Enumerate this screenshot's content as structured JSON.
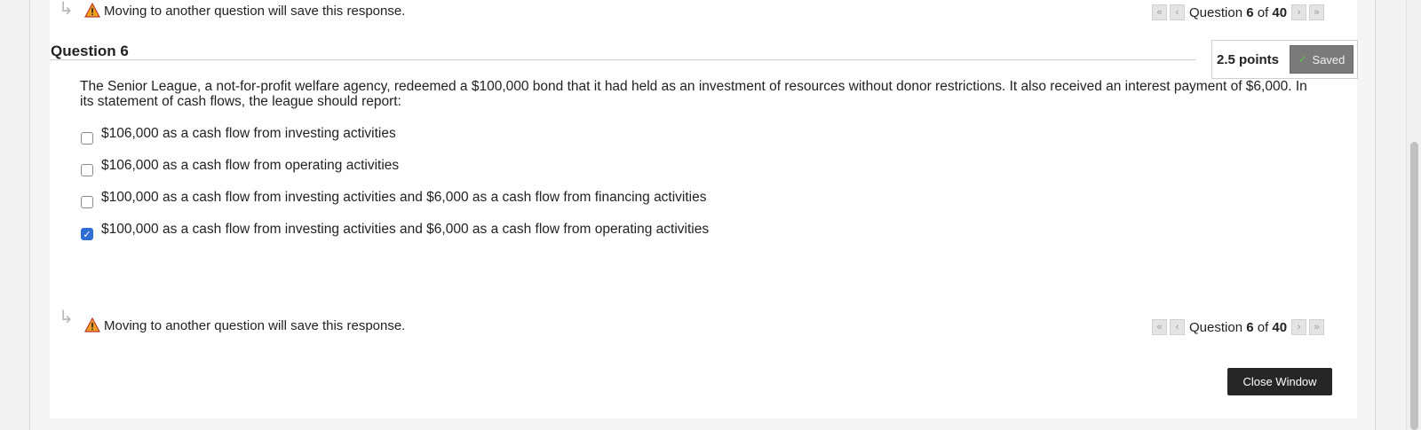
{
  "nav_top": {
    "save_note": "Moving to another question will save this response.",
    "pager": {
      "prefix": "Question",
      "current": "6",
      "of": "of",
      "total": "40"
    }
  },
  "question": {
    "title": "Question 6",
    "points": "2.5 points",
    "status": "Saved",
    "text": "The Senior League, a not-for-profit welfare agency, redeemed a $100,000 bond that it had held as an investment of resources without donor restrictions. It also received an interest payment of $6,000. In its statement of cash flows, the league should report:",
    "answers": [
      {
        "label": "$106,000 as a cash flow from investing activities",
        "checked": false
      },
      {
        "label": "$106,000 as a cash flow from operating activities",
        "checked": false
      },
      {
        "label": "$100,000 as a cash flow from investing activities and $6,000 as a cash flow from financing activities",
        "checked": false
      },
      {
        "label": "$100,000 as a cash flow from investing activities and $6,000 as a cash flow from operating activities",
        "checked": true
      }
    ]
  },
  "nav_bottom": {
    "save_note": "Moving to another question will save this response.",
    "pager": {
      "prefix": "Question",
      "current": "6",
      "of": "of",
      "total": "40"
    }
  },
  "close_button": "Close Window",
  "colors": {
    "checkbox_checked": "#2f6fd4",
    "saved_badge": "#7a7a7a",
    "close_button": "#262626",
    "warning": "#f0a020"
  },
  "icons": [
    "return-arrow-icon",
    "warning-icon",
    "first-page-icon",
    "prev-page-icon",
    "next-page-icon",
    "last-page-icon",
    "check-icon"
  ]
}
